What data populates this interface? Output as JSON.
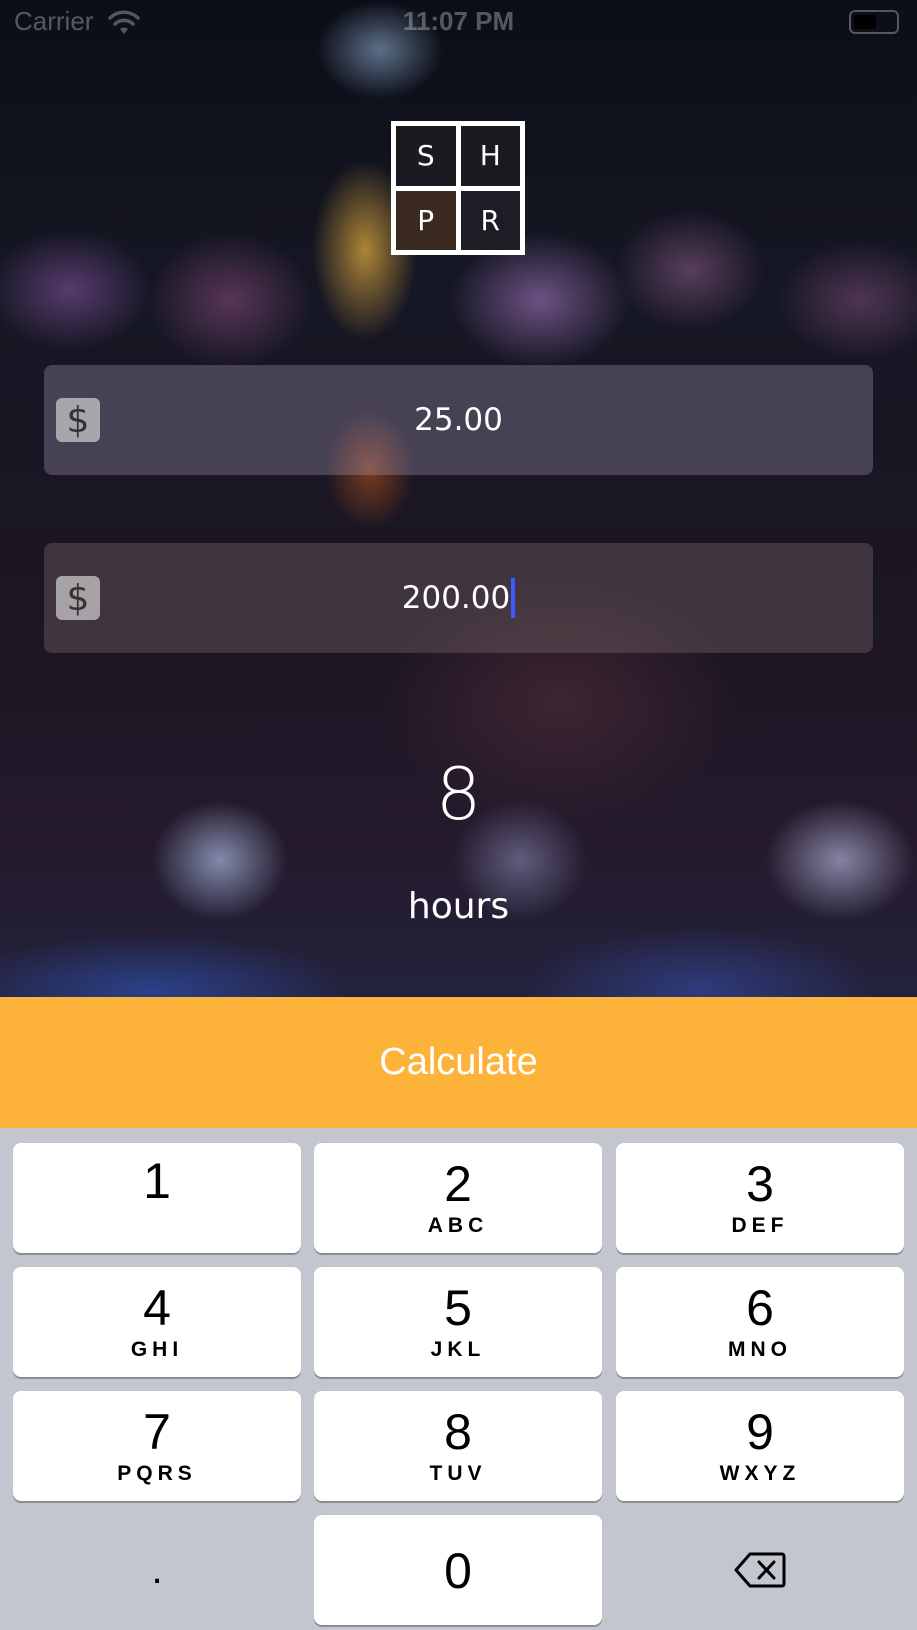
{
  "status_bar": {
    "carrier": "Carrier",
    "time": "11:07 PM",
    "icons": [
      "wifi-icon",
      "battery-icon"
    ]
  },
  "logo": {
    "letters": [
      "S",
      "H",
      "P",
      "R"
    ]
  },
  "inputs": [
    {
      "prefix": "$",
      "value": "25.00",
      "focused": false
    },
    {
      "prefix": "$",
      "value": "200.00",
      "focused": true
    }
  ],
  "result": {
    "value": "8",
    "unit": "hours"
  },
  "actions": {
    "calculate_label": "Calculate",
    "calculate_color": "#fdb23a"
  },
  "keypad": {
    "keys": [
      {
        "digit": "1",
        "letters": ""
      },
      {
        "digit": "2",
        "letters": "ABC"
      },
      {
        "digit": "3",
        "letters": "DEF"
      },
      {
        "digit": "4",
        "letters": "GHI"
      },
      {
        "digit": "5",
        "letters": "JKL"
      },
      {
        "digit": "6",
        "letters": "MNO"
      },
      {
        "digit": "7",
        "letters": "PQRS"
      },
      {
        "digit": "8",
        "letters": "TUV"
      },
      {
        "digit": "9",
        "letters": "WXYZ"
      },
      {
        "digit": "0",
        "letters": ""
      }
    ],
    "decimal": ".",
    "delete_icon": "backspace-icon"
  }
}
